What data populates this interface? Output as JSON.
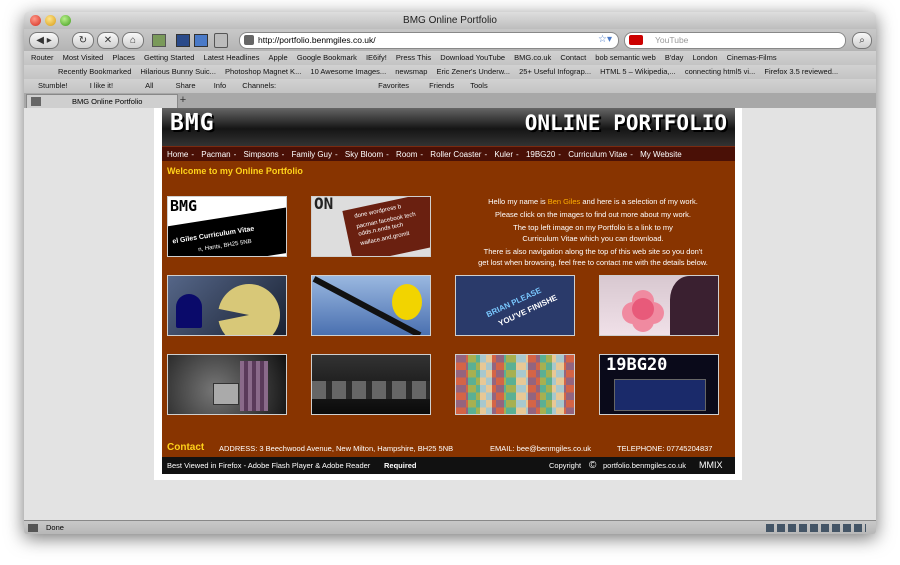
{
  "window": {
    "title": "BMG Online Portfolio"
  },
  "nav": {
    "url": "http://portfolio.benmgiles.co.uk/",
    "search_placeholder": "YouTube"
  },
  "bookmarks": [
    "Router",
    "Most Visited",
    "Places",
    "Getting Started",
    "Latest Headlines",
    "Apple",
    "Google Bookmark",
    "IE6ify!",
    "Press This",
    "Download YouTube",
    "BMG.co.uk",
    "Contact",
    "bob semantic web",
    "B'day",
    "London",
    "Cinemas-Films"
  ],
  "bookmarks2": [
    "Recently Bookmarked",
    "Hilarious Bunny Suic...",
    "Photoshop Magnet K...",
    "10 Awesome Images...",
    "newsmap",
    "Eric Zener's Underw...",
    "25+ Useful Infograp...",
    "HTML 5 – Wikipedia,...",
    "connecting html5 vi...",
    "Firefox 3.5 reviewed..."
  ],
  "toolbar3": [
    "Stumble!",
    "I like it!",
    "All",
    "Share",
    "Info",
    "Channels:",
    "Favorites",
    "Friends",
    "Tools"
  ],
  "tab": {
    "label": "BMG Online Portfolio"
  },
  "status": {
    "text": "Done"
  },
  "site": {
    "logo": "BMG",
    "title": "ONLINE PORTFOLIO",
    "menu": [
      "Home",
      "Pacman",
      "Simpsons",
      "Family Guy",
      "Sky Bloom",
      "Room",
      "Roller Coaster",
      "Kuler",
      "19BG20",
      "Curriculum Vitae",
      "My Website"
    ],
    "welcome": "Welcome to my Online Portfolio",
    "intro": {
      "l1a": "Hello my name is ",
      "name": "Ben Giles",
      "l1b": " and here is a selection of my work.",
      "l2": "Please click on the images to find out more about my work.",
      "l3": "The top left image on my Portfolio is a link to my",
      "l4": "Curriculum Vitae which you can download.",
      "l5": "There is also navigation along the top of this web site so you don't",
      "l6": "get lost when browsing, feel free to contact me with the details below."
    },
    "thumbs": {
      "cv": {
        "logo": "BMG",
        "line1": "el Giles Curriculum Vitae",
        "line2": "n, Hants, BH25 5NB"
      },
      "words": {
        "title": "ON",
        "l1": "done wordpress b",
        "l2": "pacman facebook tech",
        "l3": "odds.n.ends tech",
        "l4": "wallace.and.gromit"
      },
      "brian": {
        "l1": "BRIAN PLEASE",
        "l2": "YOU'VE FINISHE"
      },
      "bg20": {
        "label": "19BG20"
      }
    },
    "contact": {
      "label": "Contact",
      "address": "ADDRESS: 3 Beechwood Avenue, New Milton, Hampshire, BH25 5NB",
      "email": "EMAIL: bee@benmgiles.co.uk",
      "phone": "TELEPHONE: 07745204837"
    },
    "footer": {
      "best_viewed": "Best Viewed in Firefox - Adobe Flash Player & Adobe Reader",
      "required": "Required",
      "copyright": "Copyright",
      "copy_symbol": "©",
      "domain": "portfolio.benmgiles.co.uk",
      "year": "MMIX"
    }
  }
}
